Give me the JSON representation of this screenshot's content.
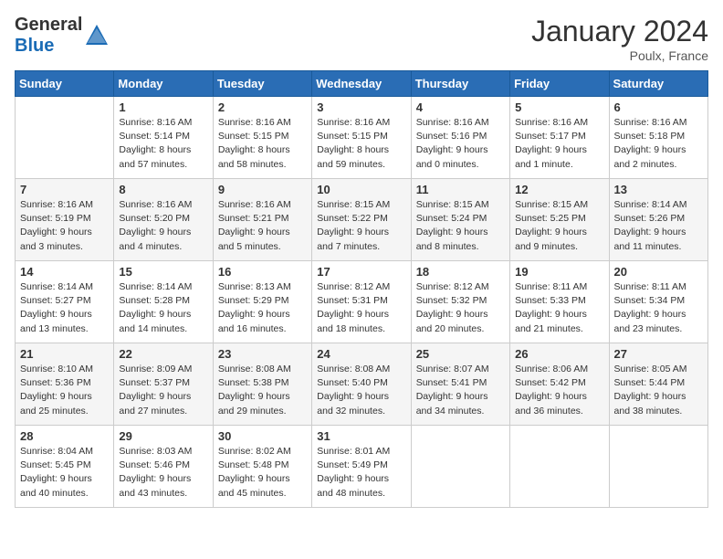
{
  "header": {
    "logo_general": "General",
    "logo_blue": "Blue",
    "title": "January 2024",
    "location": "Poulx, France"
  },
  "weekdays": [
    "Sunday",
    "Monday",
    "Tuesday",
    "Wednesday",
    "Thursday",
    "Friday",
    "Saturday"
  ],
  "weeks": [
    [
      {
        "day": "",
        "info": ""
      },
      {
        "day": "1",
        "info": "Sunrise: 8:16 AM\nSunset: 5:14 PM\nDaylight: 8 hours\nand 57 minutes."
      },
      {
        "day": "2",
        "info": "Sunrise: 8:16 AM\nSunset: 5:15 PM\nDaylight: 8 hours\nand 58 minutes."
      },
      {
        "day": "3",
        "info": "Sunrise: 8:16 AM\nSunset: 5:15 PM\nDaylight: 8 hours\nand 59 minutes."
      },
      {
        "day": "4",
        "info": "Sunrise: 8:16 AM\nSunset: 5:16 PM\nDaylight: 9 hours\nand 0 minutes."
      },
      {
        "day": "5",
        "info": "Sunrise: 8:16 AM\nSunset: 5:17 PM\nDaylight: 9 hours\nand 1 minute."
      },
      {
        "day": "6",
        "info": "Sunrise: 8:16 AM\nSunset: 5:18 PM\nDaylight: 9 hours\nand 2 minutes."
      }
    ],
    [
      {
        "day": "7",
        "info": "Sunrise: 8:16 AM\nSunset: 5:19 PM\nDaylight: 9 hours\nand 3 minutes."
      },
      {
        "day": "8",
        "info": "Sunrise: 8:16 AM\nSunset: 5:20 PM\nDaylight: 9 hours\nand 4 minutes."
      },
      {
        "day": "9",
        "info": "Sunrise: 8:16 AM\nSunset: 5:21 PM\nDaylight: 9 hours\nand 5 minutes."
      },
      {
        "day": "10",
        "info": "Sunrise: 8:15 AM\nSunset: 5:22 PM\nDaylight: 9 hours\nand 7 minutes."
      },
      {
        "day": "11",
        "info": "Sunrise: 8:15 AM\nSunset: 5:24 PM\nDaylight: 9 hours\nand 8 minutes."
      },
      {
        "day": "12",
        "info": "Sunrise: 8:15 AM\nSunset: 5:25 PM\nDaylight: 9 hours\nand 9 minutes."
      },
      {
        "day": "13",
        "info": "Sunrise: 8:14 AM\nSunset: 5:26 PM\nDaylight: 9 hours\nand 11 minutes."
      }
    ],
    [
      {
        "day": "14",
        "info": "Sunrise: 8:14 AM\nSunset: 5:27 PM\nDaylight: 9 hours\nand 13 minutes."
      },
      {
        "day": "15",
        "info": "Sunrise: 8:14 AM\nSunset: 5:28 PM\nDaylight: 9 hours\nand 14 minutes."
      },
      {
        "day": "16",
        "info": "Sunrise: 8:13 AM\nSunset: 5:29 PM\nDaylight: 9 hours\nand 16 minutes."
      },
      {
        "day": "17",
        "info": "Sunrise: 8:12 AM\nSunset: 5:31 PM\nDaylight: 9 hours\nand 18 minutes."
      },
      {
        "day": "18",
        "info": "Sunrise: 8:12 AM\nSunset: 5:32 PM\nDaylight: 9 hours\nand 20 minutes."
      },
      {
        "day": "19",
        "info": "Sunrise: 8:11 AM\nSunset: 5:33 PM\nDaylight: 9 hours\nand 21 minutes."
      },
      {
        "day": "20",
        "info": "Sunrise: 8:11 AM\nSunset: 5:34 PM\nDaylight: 9 hours\nand 23 minutes."
      }
    ],
    [
      {
        "day": "21",
        "info": "Sunrise: 8:10 AM\nSunset: 5:36 PM\nDaylight: 9 hours\nand 25 minutes."
      },
      {
        "day": "22",
        "info": "Sunrise: 8:09 AM\nSunset: 5:37 PM\nDaylight: 9 hours\nand 27 minutes."
      },
      {
        "day": "23",
        "info": "Sunrise: 8:08 AM\nSunset: 5:38 PM\nDaylight: 9 hours\nand 29 minutes."
      },
      {
        "day": "24",
        "info": "Sunrise: 8:08 AM\nSunset: 5:40 PM\nDaylight: 9 hours\nand 32 minutes."
      },
      {
        "day": "25",
        "info": "Sunrise: 8:07 AM\nSunset: 5:41 PM\nDaylight: 9 hours\nand 34 minutes."
      },
      {
        "day": "26",
        "info": "Sunrise: 8:06 AM\nSunset: 5:42 PM\nDaylight: 9 hours\nand 36 minutes."
      },
      {
        "day": "27",
        "info": "Sunrise: 8:05 AM\nSunset: 5:44 PM\nDaylight: 9 hours\nand 38 minutes."
      }
    ],
    [
      {
        "day": "28",
        "info": "Sunrise: 8:04 AM\nSunset: 5:45 PM\nDaylight: 9 hours\nand 40 minutes."
      },
      {
        "day": "29",
        "info": "Sunrise: 8:03 AM\nSunset: 5:46 PM\nDaylight: 9 hours\nand 43 minutes."
      },
      {
        "day": "30",
        "info": "Sunrise: 8:02 AM\nSunset: 5:48 PM\nDaylight: 9 hours\nand 45 minutes."
      },
      {
        "day": "31",
        "info": "Sunrise: 8:01 AM\nSunset: 5:49 PM\nDaylight: 9 hours\nand 48 minutes."
      },
      {
        "day": "",
        "info": ""
      },
      {
        "day": "",
        "info": ""
      },
      {
        "day": "",
        "info": ""
      }
    ]
  ]
}
